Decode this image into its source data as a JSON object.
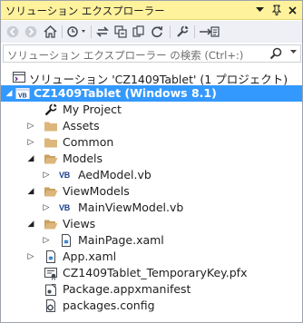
{
  "titlebar": {
    "title": "ソリューション エクスプローラー",
    "buttons": [
      "dropdown-icon",
      "pin-icon",
      "close-icon"
    ]
  },
  "toolbar": {
    "buttons": [
      "back-icon",
      "forward-icon",
      "home-icon",
      "pending-changes-icon",
      "sync-icon",
      "collapse-all-icon",
      "show-all-files-icon",
      "refresh-icon",
      "properties-icon",
      "preview-icon"
    ]
  },
  "search": {
    "placeholder": "ソリューション エクスプローラー の検索 (Ctrl+:)"
  },
  "tree": {
    "solution": "ソリューション 'CZ1409Tablet' (1 プロジェクト)",
    "project": "CZ1409Tablet (Windows 8.1)",
    "my_project": "My Project",
    "assets": "Assets",
    "common": "Common",
    "models": "Models",
    "aed_model": "AedModel.vb",
    "viewmodels": "ViewModels",
    "main_viewmodel": "MainViewModel.vb",
    "views": "Views",
    "main_page": "MainPage.xaml",
    "app_xaml": "App.xaml",
    "temp_key": "CZ1409Tablet_TemporaryKey.pfx",
    "manifest": "Package.appxmanifest",
    "packages": "packages.config",
    "vb_badge": "VB"
  },
  "colors": {
    "titlebar": "#fff29d",
    "selection": "#3399ff",
    "folder": "#dcb67a",
    "toolbar": "#eef0f5"
  }
}
